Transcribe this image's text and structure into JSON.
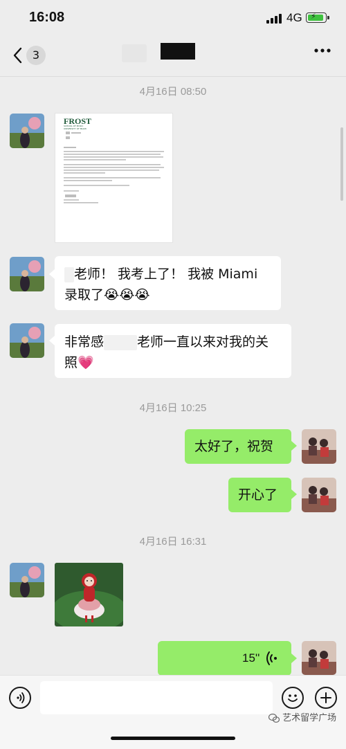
{
  "status_bar": {
    "time": "16:08",
    "network": "4G"
  },
  "nav": {
    "unread_count": "3"
  },
  "colors": {
    "background": "#ededed",
    "incoming_bubble": "#ffffff",
    "outgoing_bubble": "#95ec69",
    "timestamp": "#9a9a9a"
  },
  "doc_preview": {
    "letterhead_line1": "FROST",
    "letterhead_line2": "SCHOOL OF MUSIC",
    "letterhead_line3": "UNIVERSITY OF MIAMI"
  },
  "messages": {
    "ts1": "4月16日 08:50",
    "m2_line1": "老师！ 我考上了！ 我被 Miami",
    "m2_line2": "录取了",
    "m2_emojis": "😭😭😭",
    "m3_line1a": "非常感",
    "m3_line1b": "老师一直以来对我的关",
    "m3_line2": "照",
    "m3_emoji": "💗",
    "ts2": "4月16日 10:25",
    "m4": "太好了，祝贺",
    "m5": "开心了",
    "ts3": "4月16日 16:31",
    "m7_duration": "15''"
  },
  "icons": {
    "back": "chevron-left-icon",
    "more": "more-dots-icon",
    "voice": "voice-input-icon",
    "emoji": "emoji-icon",
    "add": "plus-icon",
    "voice_wave": "voice-wave-icon"
  },
  "watermark": "艺术留学广场"
}
